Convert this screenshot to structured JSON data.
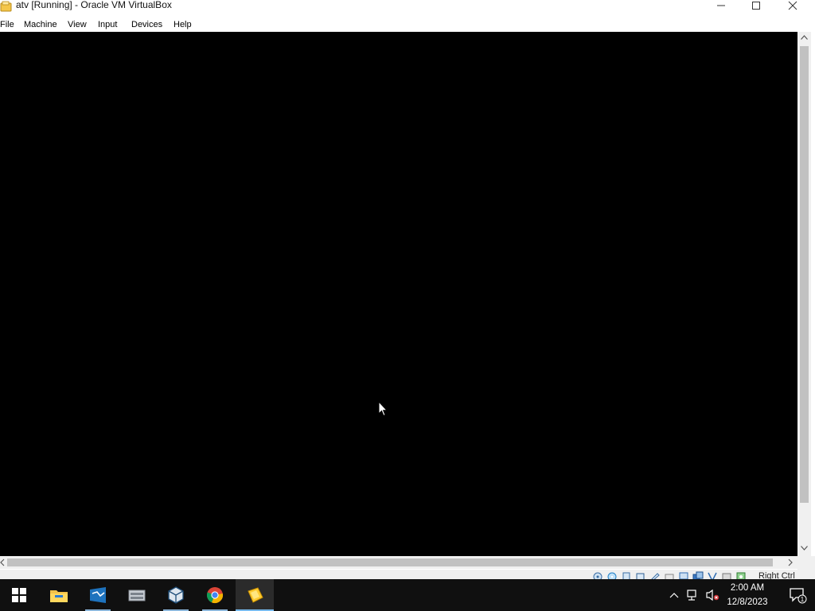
{
  "window": {
    "title": "atv [Running] - Oracle VM VirtualBox",
    "icon": "virtualbox-vm-icon",
    "controls": [
      "minimize-icon",
      "maximize-icon",
      "close-icon"
    ]
  },
  "menubar": {
    "items": [
      {
        "label": "File"
      },
      {
        "label": "Machine"
      },
      {
        "label": "View"
      },
      {
        "label": "Input"
      },
      {
        "label": "Devices"
      },
      {
        "label": "Help"
      }
    ]
  },
  "vm_display": {
    "background": "#000000",
    "cursor": "arrow-pointer-icon"
  },
  "statusbar": {
    "icons": [
      "hard-disk-icon",
      "optical-drive-icon",
      "audio-icon",
      "network-icon",
      "usb-icon",
      "shared-folders-icon",
      "display-icon",
      "video-capture-icon",
      "mouse-integration-icon",
      "cpu-icon",
      "host-key-icon"
    ],
    "host_key_label": "Right Ctrl"
  },
  "taskbar": {
    "start": "windows-start-icon",
    "apps": [
      {
        "name": "file-explorer-icon",
        "running": false
      },
      {
        "name": "server-manager-icon",
        "running": true
      },
      {
        "name": "storage-icon",
        "running": false
      },
      {
        "name": "virtualbox-icon",
        "running": true
      },
      {
        "name": "chrome-icon",
        "running": true
      },
      {
        "name": "vm-window-icon",
        "running": true,
        "active": true
      }
    ],
    "tray": {
      "icons": [
        "chevron-up-icon",
        "network-icon",
        "volume-muted-icon"
      ],
      "time": "2:00 AM",
      "date": "12/8/2023",
      "notification_count": "1"
    }
  }
}
